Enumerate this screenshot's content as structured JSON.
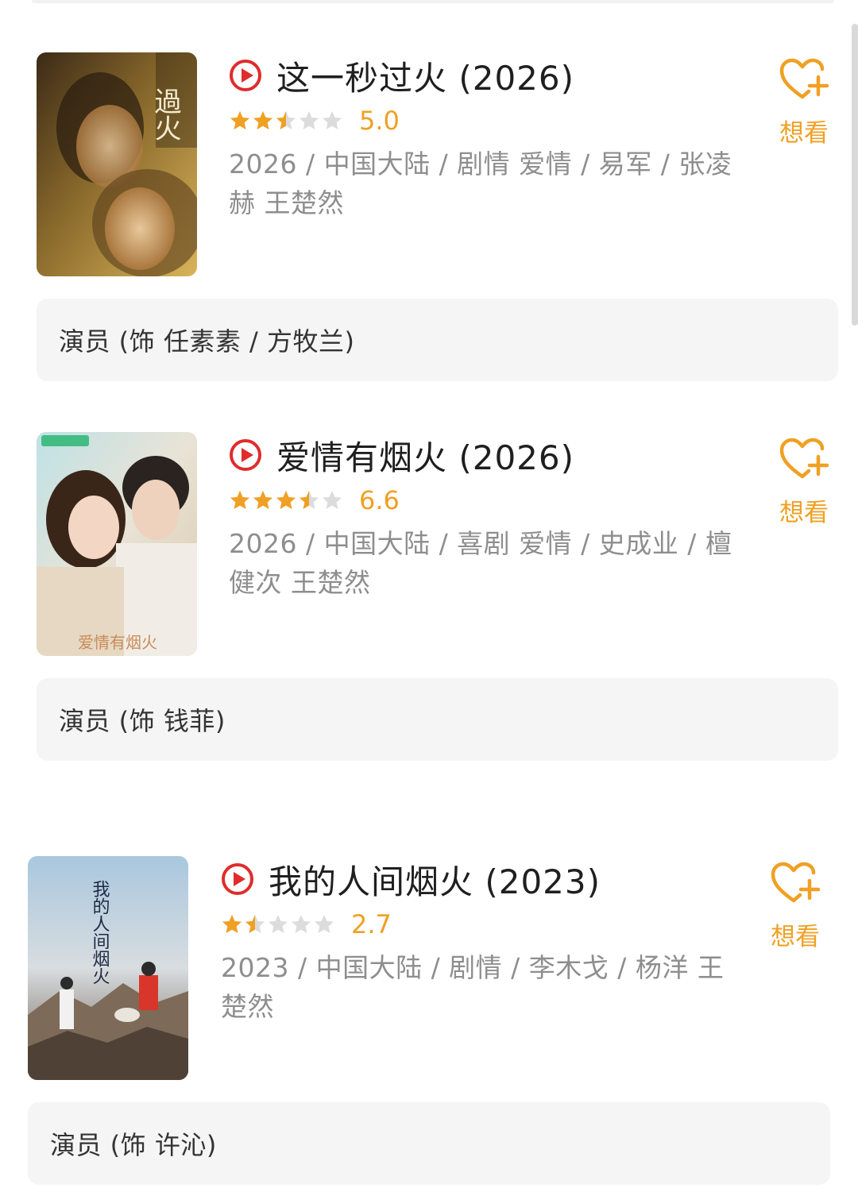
{
  "colors": {
    "accent": "#f0a023",
    "play_red": "#e02c2c",
    "title": "#1f1f1f",
    "meta": "#8e8e8e",
    "role_bg": "#f5f5f5"
  },
  "movies": [
    {
      "title": "这一秒过火 (2026)",
      "rating": 5.0,
      "score_text": "5.0",
      "meta": "2026 / 中国大陆 / 剧情 爱情 / 易军 / 张凌赫 王楚然",
      "wish_label": "想看",
      "role": "演员 (饰 任素素 / 方牧兰)",
      "poster_icon": "poster-image",
      "poster_title_text": "過火"
    },
    {
      "title": "爱情有烟火 (2026)",
      "rating": 6.6,
      "score_text": "6.6",
      "meta": "2026 / 中国大陆 / 喜剧 爱情 / 史成业 / 檀健次 王楚然",
      "wish_label": "想看",
      "role": "演员 (饰 钱菲)",
      "poster_icon": "poster-image",
      "poster_title_text": "爱情有烟火"
    },
    {
      "title": "我的人间烟火 (2023)",
      "rating": 2.7,
      "score_text": "2.7",
      "meta": "2023 / 中国大陆 / 剧情 / 李木戈 / 杨洋 王楚然",
      "wish_label": "想看",
      "role": "演员 (饰 许沁)",
      "poster_icon": "poster-image",
      "poster_title_text": "我的人间烟火"
    }
  ]
}
